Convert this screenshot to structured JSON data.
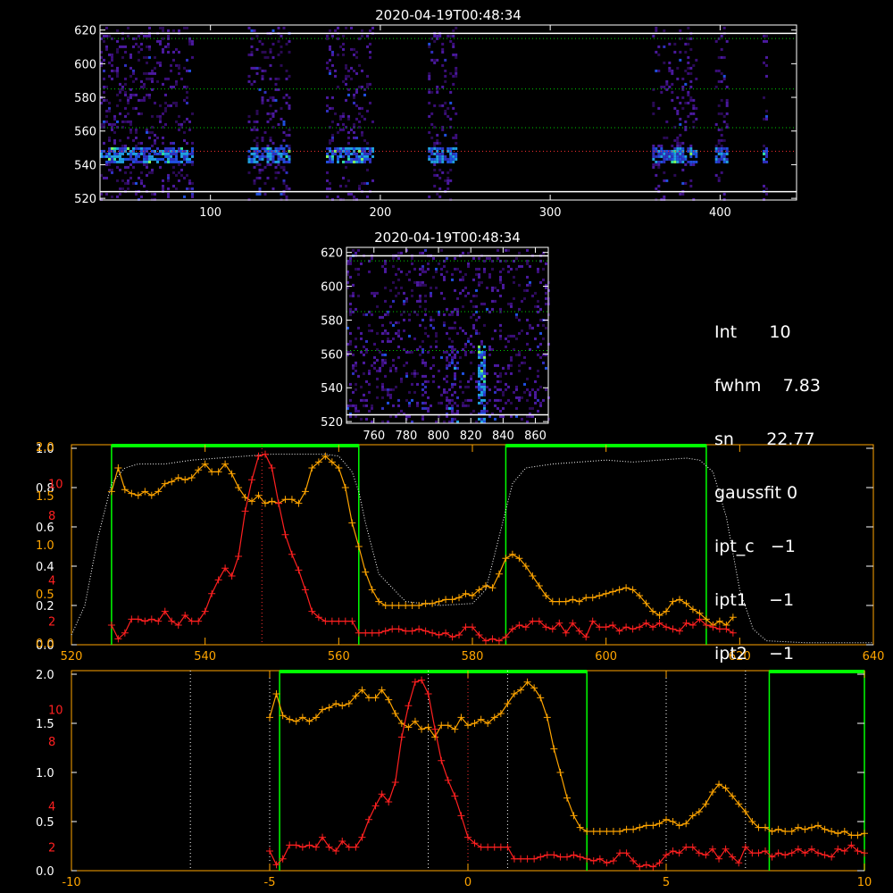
{
  "panels": {
    "top_title": "2020-04-19T00:48:34",
    "mid_title": "2020-04-19T00:48:34"
  },
  "colors": {
    "orange": "#ffa500",
    "red": "#ff2020",
    "green": "#00ff00",
    "white": "#ffffff",
    "dotted_green": "#00cc00",
    "dotted_red": "#ff3030"
  },
  "info": [
    {
      "label": "Int",
      "value": "10"
    },
    {
      "label": "fwhm",
      "value": "7.83"
    },
    {
      "label": "sn",
      "value": "22.77"
    },
    {
      "label": "gaussfit",
      "value": "0"
    },
    {
      "label": "ipt_c",
      "value": "−1"
    },
    {
      "label": "ipt1",
      "value": "−1"
    },
    {
      "label": "ipt2",
      "value": "−1"
    }
  ],
  "chart_data": [
    {
      "type": "heatmap",
      "title": "2020-04-19T00:48:34",
      "xlim": [
        35,
        445
      ],
      "ylim": [
        519,
        623
      ],
      "xticks": [
        100,
        200,
        300,
        400
      ],
      "yticks": [
        520,
        540,
        560,
        580,
        600,
        620
      ],
      "bright_row_y": 546,
      "bands_x": [
        [
          35,
          90
        ],
        [
          122,
          147
        ],
        [
          168,
          195
        ],
        [
          228,
          245
        ],
        [
          360,
          386
        ],
        [
          397,
          404
        ],
        [
          425,
          428
        ]
      ],
      "hlines_white": [
        618,
        524
      ],
      "hlines_green_dotted": [
        615,
        585,
        562
      ],
      "hlines_red_dotted": [
        548
      ]
    },
    {
      "type": "heatmap",
      "title": "2020-04-19T00:48:34",
      "xlim": [
        743,
        868
      ],
      "ylim": [
        519,
        623
      ],
      "xticks": [
        760,
        780,
        800,
        820,
        840,
        860
      ],
      "yticks": [
        520,
        540,
        560,
        580,
        600,
        620
      ],
      "hlines_white": [
        618,
        524
      ],
      "hlines_green_dotted": [
        615,
        585,
        562
      ]
    },
    {
      "type": "line",
      "xlim": [
        520,
        640
      ],
      "xticks": [
        520,
        540,
        560,
        580,
        600,
        620,
        640
      ],
      "left_ticks_white": [
        "0.0",
        "0.2",
        "0.4",
        "0.6",
        "0.8",
        "1.0"
      ],
      "left_ticks_red": [
        "0.0",
        "0.5",
        "1.0",
        "1.5",
        "2.0"
      ],
      "left_ticks_int": [
        "2",
        "4",
        "8",
        "10"
      ],
      "green_boxes": [
        [
          526,
          563
        ],
        [
          585,
          615
        ]
      ],
      "red_center_x": 548.5,
      "dotted_transmission": {
        "x": [
          520,
          522,
          524,
          526,
          528,
          530,
          534,
          538,
          542,
          546,
          550,
          554,
          558,
          560,
          562,
          563,
          564,
          566,
          570,
          575,
          580,
          582,
          584,
          586,
          588,
          592,
          596,
          600,
          604,
          608,
          612,
          614,
          616,
          618,
          620,
          622,
          624,
          630,
          640
        ],
        "y": [
          0.05,
          0.2,
          0.55,
          0.82,
          0.9,
          0.92,
          0.92,
          0.94,
          0.95,
          0.96,
          0.97,
          0.97,
          0.97,
          0.96,
          0.88,
          0.78,
          0.62,
          0.36,
          0.22,
          0.2,
          0.21,
          0.28,
          0.55,
          0.82,
          0.9,
          0.92,
          0.93,
          0.94,
          0.93,
          0.94,
          0.95,
          0.94,
          0.88,
          0.65,
          0.28,
          0.08,
          0.02,
          0.01,
          0.01
        ]
      },
      "series": [
        {
          "x": [
            526,
            527,
            528,
            529,
            530,
            531,
            532,
            533,
            534,
            535,
            536,
            537,
            538,
            539,
            540,
            541,
            542,
            543,
            544,
            545,
            546,
            547,
            548,
            549,
            550,
            551,
            552,
            553,
            554,
            555,
            556,
            557,
            558,
            559,
            560,
            561,
            562,
            563,
            564,
            565,
            566,
            567,
            568,
            569,
            570,
            571,
            572,
            573,
            574,
            575,
            576,
            577,
            578,
            579,
            580,
            581,
            582,
            583,
            584,
            585,
            586,
            587,
            588,
            589,
            590,
            591,
            592,
            593,
            594,
            595,
            596,
            597,
            598,
            599,
            600,
            601,
            602,
            603,
            604,
            605,
            606,
            607,
            608,
            609,
            610,
            611,
            612,
            613,
            614,
            615,
            616,
            617,
            618,
            619
          ],
          "y": [
            0.78,
            0.9,
            0.79,
            0.77,
            0.76,
            0.78,
            0.76,
            0.78,
            0.82,
            0.83,
            0.85,
            0.84,
            0.85,
            0.89,
            0.92,
            0.88,
            0.88,
            0.92,
            0.87,
            0.8,
            0.75,
            0.73,
            0.76,
            0.72,
            0.73,
            0.72,
            0.74,
            0.74,
            0.72,
            0.78,
            0.9,
            0.93,
            0.96,
            0.93,
            0.9,
            0.8,
            0.62,
            0.5,
            0.37,
            0.28,
            0.22,
            0.2,
            0.2,
            0.2,
            0.2,
            0.2,
            0.2,
            0.21,
            0.21,
            0.22,
            0.23,
            0.23,
            0.24,
            0.26,
            0.25,
            0.28,
            0.3,
            0.29,
            0.36,
            0.44,
            0.46,
            0.44,
            0.4,
            0.35,
            0.3,
            0.25,
            0.22,
            0.22,
            0.22,
            0.23,
            0.22,
            0.24,
            0.24,
            0.25,
            0.26,
            0.27,
            0.28,
            0.29,
            0.28,
            0.25,
            0.21,
            0.17,
            0.15,
            0.17,
            0.22,
            0.23,
            0.21,
            0.18,
            0.16,
            0.13,
            0.1,
            0.12,
            0.1,
            0.14
          ]
        },
        {
          "x": [
            526,
            527,
            528,
            529,
            530,
            531,
            532,
            533,
            534,
            535,
            536,
            537,
            538,
            539,
            540,
            541,
            542,
            543,
            544,
            545,
            546,
            547,
            548,
            549,
            550,
            551,
            552,
            553,
            554,
            555,
            556,
            557,
            558,
            559,
            560,
            561,
            562,
            563,
            564,
            565,
            566,
            567,
            568,
            569,
            570,
            571,
            572,
            573,
            574,
            575,
            576,
            577,
            578,
            579,
            580,
            581,
            582,
            583,
            584,
            585,
            586,
            587,
            588,
            589,
            590,
            591,
            592,
            593,
            594,
            595,
            596,
            597,
            598,
            599,
            600,
            601,
            602,
            603,
            604,
            605,
            606,
            607,
            608,
            609,
            610,
            611,
            612,
            613,
            614,
            615,
            616,
            617,
            618,
            619
          ],
          "y": [
            0.1,
            0.03,
            0.06,
            0.13,
            0.13,
            0.12,
            0.13,
            0.12,
            0.17,
            0.12,
            0.1,
            0.15,
            0.12,
            0.12,
            0.17,
            0.26,
            0.33,
            0.39,
            0.35,
            0.45,
            0.68,
            0.84,
            0.96,
            0.97,
            0.9,
            0.72,
            0.56,
            0.46,
            0.38,
            0.28,
            0.17,
            0.14,
            0.12,
            0.12,
            0.12,
            0.12,
            0.12,
            0.06,
            0.06,
            0.06,
            0.06,
            0.07,
            0.08,
            0.08,
            0.07,
            0.07,
            0.08,
            0.07,
            0.06,
            0.05,
            0.06,
            0.04,
            0.05,
            0.09,
            0.09,
            0.05,
            0.02,
            0.03,
            0.02,
            0.04,
            0.08,
            0.1,
            0.09,
            0.12,
            0.12,
            0.09,
            0.08,
            0.11,
            0.06,
            0.11,
            0.07,
            0.04,
            0.12,
            0.09,
            0.09,
            0.1,
            0.07,
            0.09,
            0.08,
            0.09,
            0.11,
            0.09,
            0.11,
            0.09,
            0.08,
            0.07,
            0.11,
            0.1,
            0.13,
            0.1,
            0.09,
            0.08,
            0.08,
            0.06
          ]
        }
      ]
    },
    {
      "type": "line",
      "xlim": [
        -10,
        10
      ],
      "xticks": [
        -10,
        -5,
        0,
        5,
        10
      ],
      "left_ticks_white": [
        "0.0",
        "0.5",
        "1.0",
        "1.5",
        "2.0"
      ],
      "left_ticks_int": [
        "2",
        "4",
        "8",
        "10"
      ],
      "green_boxes": [
        [
          -4.75,
          3.0
        ],
        [
          7.6,
          10.2
        ]
      ],
      "dotted_vlines_white": [
        -7,
        -5,
        -1,
        1,
        5,
        7
      ],
      "red_center_x": 0,
      "series": [
        {
          "x": [
            -5.0,
            -4.83,
            -4.67,
            -4.5,
            -4.33,
            -4.17,
            -4.0,
            -3.83,
            -3.67,
            -3.5,
            -3.33,
            -3.17,
            -3.0,
            -2.83,
            -2.67,
            -2.5,
            -2.33,
            -2.17,
            -2.0,
            -1.83,
            -1.67,
            -1.5,
            -1.33,
            -1.17,
            -1.0,
            -0.83,
            -0.67,
            -0.5,
            -0.33,
            -0.17,
            0.0,
            0.17,
            0.33,
            0.5,
            0.67,
            0.83,
            1.0,
            1.17,
            1.33,
            1.5,
            1.67,
            1.83,
            2.0,
            2.17,
            2.33,
            2.5,
            2.67,
            2.83,
            3.0,
            3.17,
            3.33,
            3.5,
            3.67,
            3.83,
            4.0,
            4.17,
            4.33,
            4.5,
            4.67,
            4.83,
            5.0,
            5.17,
            5.33,
            5.5,
            5.67,
            5.83,
            6.0,
            6.17,
            6.33,
            6.5,
            6.67,
            6.83,
            7.0,
            7.17,
            7.33,
            7.5,
            7.67,
            7.83,
            8.0,
            8.17,
            8.33,
            8.5,
            8.67,
            8.83,
            9.0,
            9.17,
            9.33,
            9.5,
            9.67,
            9.83,
            10.0
          ],
          "y": [
            0.78,
            0.9,
            0.79,
            0.77,
            0.76,
            0.78,
            0.76,
            0.78,
            0.82,
            0.83,
            0.85,
            0.84,
            0.85,
            0.89,
            0.92,
            0.88,
            0.88,
            0.92,
            0.87,
            0.8,
            0.75,
            0.73,
            0.76,
            0.72,
            0.73,
            0.68,
            0.74,
            0.74,
            0.72,
            0.78,
            0.74,
            0.75,
            0.77,
            0.75,
            0.78,
            0.8,
            0.85,
            0.9,
            0.92,
            0.96,
            0.93,
            0.88,
            0.78,
            0.62,
            0.5,
            0.37,
            0.28,
            0.22,
            0.2,
            0.2,
            0.2,
            0.2,
            0.2,
            0.2,
            0.21,
            0.21,
            0.22,
            0.23,
            0.23,
            0.24,
            0.26,
            0.25,
            0.23,
            0.24,
            0.28,
            0.3,
            0.34,
            0.4,
            0.44,
            0.42,
            0.38,
            0.34,
            0.3,
            0.25,
            0.22,
            0.22,
            0.2,
            0.21,
            0.2,
            0.2,
            0.22,
            0.21,
            0.22,
            0.23,
            0.21,
            0.2,
            0.19,
            0.2,
            0.18,
            0.18,
            0.19
          ]
        },
        {
          "x": [
            -5.0,
            -4.83,
            -4.67,
            -4.5,
            -4.33,
            -4.17,
            -4.0,
            -3.83,
            -3.67,
            -3.5,
            -3.33,
            -3.17,
            -3.0,
            -2.83,
            -2.67,
            -2.5,
            -2.33,
            -2.17,
            -2.0,
            -1.83,
            -1.67,
            -1.5,
            -1.33,
            -1.17,
            -1.0,
            -0.83,
            -0.67,
            -0.5,
            -0.33,
            -0.17,
            0.0,
            0.17,
            0.33,
            0.5,
            0.67,
            0.83,
            1.0,
            1.17,
            1.33,
            1.5,
            1.67,
            1.83,
            2.0,
            2.17,
            2.33,
            2.5,
            2.67,
            2.83,
            3.0,
            3.17,
            3.33,
            3.5,
            3.67,
            3.83,
            4.0,
            4.17,
            4.33,
            4.5,
            4.67,
            4.83,
            5.0,
            5.17,
            5.33,
            5.5,
            5.67,
            5.83,
            6.0,
            6.17,
            6.33,
            6.5,
            6.67,
            6.83,
            7.0,
            7.17,
            7.33,
            7.5,
            7.67,
            7.83,
            8.0,
            8.17,
            8.33,
            8.5,
            8.67,
            8.83,
            9.0,
            9.17,
            9.33,
            9.5,
            9.67,
            9.83,
            10.0
          ],
          "y": [
            0.1,
            0.03,
            0.06,
            0.13,
            0.13,
            0.12,
            0.13,
            0.12,
            0.17,
            0.12,
            0.1,
            0.15,
            0.12,
            0.12,
            0.17,
            0.26,
            0.33,
            0.39,
            0.35,
            0.45,
            0.68,
            0.84,
            0.96,
            0.97,
            0.9,
            0.72,
            0.56,
            0.46,
            0.38,
            0.28,
            0.17,
            0.14,
            0.12,
            0.12,
            0.12,
            0.12,
            0.12,
            0.06,
            0.06,
            0.06,
            0.06,
            0.07,
            0.08,
            0.08,
            0.07,
            0.07,
            0.08,
            0.07,
            0.06,
            0.05,
            0.06,
            0.04,
            0.05,
            0.09,
            0.09,
            0.05,
            0.02,
            0.03,
            0.02,
            0.04,
            0.08,
            0.1,
            0.09,
            0.12,
            0.12,
            0.09,
            0.08,
            0.11,
            0.06,
            0.11,
            0.07,
            0.04,
            0.12,
            0.09,
            0.09,
            0.1,
            0.07,
            0.09,
            0.08,
            0.09,
            0.11,
            0.09,
            0.11,
            0.09,
            0.08,
            0.07,
            0.11,
            0.1,
            0.13,
            0.1,
            0.09
          ]
        }
      ]
    }
  ]
}
